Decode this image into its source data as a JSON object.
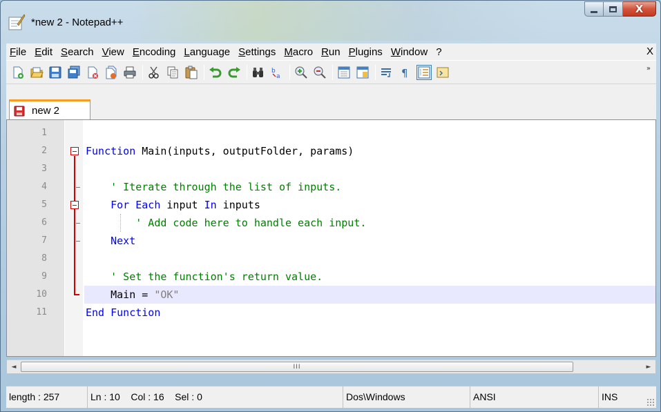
{
  "window": {
    "title": "*new  2 - Notepad++",
    "app_icon": "notepadpp-icon",
    "buttons": [
      "minimize-icon",
      "maximize-icon",
      "close-icon"
    ],
    "close_glyph": "X"
  },
  "menu": {
    "items": [
      "File",
      "Edit",
      "Search",
      "View",
      "Encoding",
      "Language",
      "Settings",
      "Macro",
      "Run",
      "Plugins",
      "Window",
      "?"
    ],
    "close_label": "X"
  },
  "toolbar": {
    "icons": [
      "new-file-icon",
      "open-file-icon",
      "save-icon",
      "save-all-icon",
      "close-icon",
      "close-all-icon",
      "print-icon",
      "cut-icon",
      "copy-icon",
      "paste-icon",
      "undo-icon",
      "redo-icon",
      "find-icon",
      "replace-icon",
      "zoom-in-icon",
      "zoom-out-icon",
      "sync-vertical-icon",
      "sync-horizontal-icon",
      "word-wrap-icon",
      "show-all-characters-icon",
      "indent-guide-icon",
      "user-defined-language-icon"
    ],
    "overflow": "»"
  },
  "tabs": [
    {
      "label": "new 2",
      "icon": "unsaved-file-icon",
      "active": true
    }
  ],
  "editor": {
    "current_line": 10,
    "lines": [
      {
        "num": "1",
        "segments": []
      },
      {
        "num": "2",
        "segments": [
          {
            "t": "kw",
            "s": "Function"
          },
          {
            "t": "plain",
            "s": " Main(inputs, outputFolder, params)"
          }
        ]
      },
      {
        "num": "3",
        "segments": []
      },
      {
        "num": "4",
        "segments": [
          {
            "t": "plain",
            "s": "    "
          },
          {
            "t": "cm",
            "s": "' Iterate through the list of inputs."
          }
        ]
      },
      {
        "num": "5",
        "segments": [
          {
            "t": "plain",
            "s": "    "
          },
          {
            "t": "kw",
            "s": "For Each"
          },
          {
            "t": "plain",
            "s": " input "
          },
          {
            "t": "kw",
            "s": "In"
          },
          {
            "t": "plain",
            "s": " inputs"
          }
        ]
      },
      {
        "num": "6",
        "segments": [
          {
            "t": "plain",
            "s": "        "
          },
          {
            "t": "cm",
            "s": "' Add code here to handle each input."
          }
        ]
      },
      {
        "num": "7",
        "segments": [
          {
            "t": "plain",
            "s": "    "
          },
          {
            "t": "kw",
            "s": "Next"
          }
        ]
      },
      {
        "num": "8",
        "segments": []
      },
      {
        "num": "9",
        "segments": [
          {
            "t": "plain",
            "s": "    "
          },
          {
            "t": "cm",
            "s": "' Set the function's return value."
          }
        ]
      },
      {
        "num": "10",
        "segments": [
          {
            "t": "plain",
            "s": "    Main = "
          },
          {
            "t": "str",
            "s": "\"OK\""
          }
        ]
      },
      {
        "num": "11",
        "segments": [
          {
            "t": "kw",
            "s": "End Function"
          }
        ]
      }
    ]
  },
  "scrollbar": {
    "left": "◄",
    "right": "►",
    "grip": "III"
  },
  "status": {
    "length": "length : 257",
    "position": "Ln : 10    Col : 16    Sel : 0",
    "eol": "Dos\\Windows",
    "encoding": "ANSI",
    "mode": "INS"
  },
  "colors": {
    "keyword": "#0000ff",
    "comment": "#008000",
    "string": "#808080",
    "fold_marker": "#d40000",
    "current_line": "#e8e8ff",
    "tab_accent": "#fa9b21"
  }
}
